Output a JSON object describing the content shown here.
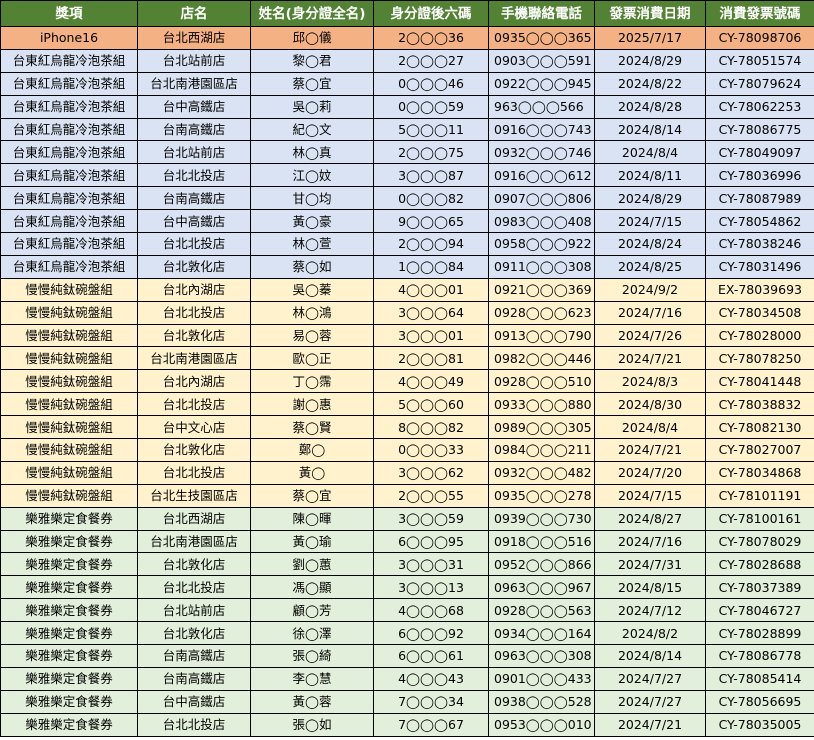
{
  "header": [
    "獎項",
    "店名",
    "姓名(身分證全名)",
    "身分證後六碼",
    "手機聯絡電話",
    "發票消費日期",
    "消費發票號碼"
  ],
  "group_colors": {
    "iphone": "#f4b183",
    "tea": "#dae3f3",
    "bowl": "#fff2cc",
    "voucher": "#e2efda",
    "header": "#548235"
  },
  "rows": [
    {
      "group": "iphone",
      "prize": "iPhone16",
      "store": "台北西湖店",
      "name": "邱◯儀",
      "id": "2◯◯◯36",
      "phone": "0935◯◯◯365",
      "date": "2025/7/17",
      "invoice": "CY-78098706"
    },
    {
      "group": "tea",
      "prize": "台東紅烏龍冷泡茶組",
      "store": "台北站前店",
      "name": "黎◯君",
      "id": "2◯◯◯27",
      "phone": "0903◯◯◯591",
      "date": "2024/8/29",
      "invoice": "CY-78051574"
    },
    {
      "group": "tea",
      "prize": "台東紅烏龍冷泡茶組",
      "store": "台北南港園區店",
      "name": "蔡◯宜",
      "id": "0◯◯◯46",
      "phone": "0922◯◯◯945",
      "date": "2024/8/22",
      "invoice": "CY-78079624"
    },
    {
      "group": "tea",
      "prize": "台東紅烏龍冷泡茶組",
      "store": "台中高鐵店",
      "name": "吳◯莉",
      "id": "0◯◯◯59",
      "phone": "963◯◯◯566",
      "date": "2024/8/28",
      "invoice": "CY-78062253"
    },
    {
      "group": "tea",
      "prize": "台東紅烏龍冷泡茶組",
      "store": "台南高鐵店",
      "name": "紀◯文",
      "id": "5◯◯◯11",
      "phone": "0916◯◯◯743",
      "date": "2024/8/14",
      "invoice": "CY-78086775"
    },
    {
      "group": "tea",
      "prize": "台東紅烏龍冷泡茶組",
      "store": "台北站前店",
      "name": "林◯真",
      "id": "2◯◯◯75",
      "phone": "0932◯◯◯746",
      "date": "2024/8/4",
      "invoice": "CY-78049097"
    },
    {
      "group": "tea",
      "prize": "台東紅烏龍冷泡茶組",
      "store": "台北北投店",
      "name": "江◯妏",
      "id": "3◯◯◯87",
      "phone": "0916◯◯◯612",
      "date": "2024/8/11",
      "invoice": "CY-78036996"
    },
    {
      "group": "tea",
      "prize": "台東紅烏龍冷泡茶組",
      "store": "台南高鐵店",
      "name": "甘◯均",
      "id": "0◯◯◯82",
      "phone": "0907◯◯◯806",
      "date": "2024/8/29",
      "invoice": "CY-78087989"
    },
    {
      "group": "tea",
      "prize": "台東紅烏龍冷泡茶組",
      "store": "台中高鐵店",
      "name": "黃◯豪",
      "id": "9◯◯◯65",
      "phone": "0983◯◯◯408",
      "date": "2024/7/15",
      "invoice": "CY-78054862"
    },
    {
      "group": "tea",
      "prize": "台東紅烏龍冷泡茶組",
      "store": "台北北投店",
      "name": "林◯萱",
      "id": "2◯◯◯94",
      "phone": "0958◯◯◯922",
      "date": "2024/8/24",
      "invoice": "CY-78038246"
    },
    {
      "group": "tea",
      "prize": "台東紅烏龍冷泡茶組",
      "store": "台北敦化店",
      "name": "蔡◯如",
      "id": "1◯◯◯84",
      "phone": "0911◯◯◯308",
      "date": "2024/8/25",
      "invoice": "CY-78031496"
    },
    {
      "group": "bowl",
      "prize": "慢慢純鈦碗盤組",
      "store": "台北內湖店",
      "name": "吳◯蓁",
      "id": "4◯◯◯01",
      "phone": "0921◯◯◯369",
      "date": "2024/9/2",
      "invoice": "EX-78039693"
    },
    {
      "group": "bowl",
      "prize": "慢慢純鈦碗盤組",
      "store": "台北北投店",
      "name": "林◯鴻",
      "id": "3◯◯◯64",
      "phone": "0928◯◯◯623",
      "date": "2024/7/16",
      "invoice": "CY-78034508"
    },
    {
      "group": "bowl",
      "prize": "慢慢純鈦碗盤組",
      "store": "台北敦化店",
      "name": "易◯蓉",
      "id": "3◯◯◯01",
      "phone": "0913◯◯◯790",
      "date": "2024/7/26",
      "invoice": "CY-78028000"
    },
    {
      "group": "bowl",
      "prize": "慢慢純鈦碗盤組",
      "store": "台北南港園區店",
      "name": "歐◯正",
      "id": "2◯◯◯81",
      "phone": "0982◯◯◯446",
      "date": "2024/7/21",
      "invoice": "CY-78078250"
    },
    {
      "group": "bowl",
      "prize": "慢慢純鈦碗盤組",
      "store": "台北內湖店",
      "name": "丁◯霈",
      "id": "4◯◯◯49",
      "phone": "0928◯◯◯510",
      "date": "2024/8/3",
      "invoice": "CY-78041448"
    },
    {
      "group": "bowl",
      "prize": "慢慢純鈦碗盤組",
      "store": "台北北投店",
      "name": "謝◯惠",
      "id": "5◯◯◯60",
      "phone": "0933◯◯◯880",
      "date": "2024/8/30",
      "invoice": "CY-78038832"
    },
    {
      "group": "bowl",
      "prize": "慢慢純鈦碗盤組",
      "store": "台中文心店",
      "name": "蔡◯賢",
      "id": "8◯◯◯82",
      "phone": "0989◯◯◯305",
      "date": "2024/8/4",
      "invoice": "CY-78082130"
    },
    {
      "group": "bowl",
      "prize": "慢慢純鈦碗盤組",
      "store": "台北敦化店",
      "name": "鄭◯",
      "id": "0◯◯◯33",
      "phone": "0984◯◯◯211",
      "date": "2024/7/21",
      "invoice": "CY-78027007"
    },
    {
      "group": "bowl",
      "prize": "慢慢純鈦碗盤組",
      "store": "台北北投店",
      "name": "黃◯",
      "id": "3◯◯◯62",
      "phone": "0932◯◯◯482",
      "date": "2024/7/20",
      "invoice": "CY-78034868"
    },
    {
      "group": "bowl",
      "prize": "慢慢純鈦碗盤組",
      "store": "台北生技園區店",
      "name": "蔡◯宜",
      "id": "2◯◯◯55",
      "phone": "0935◯◯◯278",
      "date": "2024/7/15",
      "invoice": "CY-78101191"
    },
    {
      "group": "voucher",
      "prize": "樂雅樂定食餐券",
      "store": "台北西湖店",
      "name": "陳◯暉",
      "id": "3◯◯◯59",
      "phone": "0939◯◯◯730",
      "date": "2024/8/27",
      "invoice": "CY-78100161"
    },
    {
      "group": "voucher",
      "prize": "樂雅樂定食餐券",
      "store": "台北南港園區店",
      "name": "黃◯瑜",
      "id": "6◯◯◯95",
      "phone": "0918◯◯◯516",
      "date": "2024/7/16",
      "invoice": "CY-78078029"
    },
    {
      "group": "voucher",
      "prize": "樂雅樂定食餐券",
      "store": "台北敦化店",
      "name": "劉◯蕙",
      "id": "3◯◯◯31",
      "phone": "0952◯◯◯866",
      "date": "2024/7/31",
      "invoice": "CY-78028688"
    },
    {
      "group": "voucher",
      "prize": "樂雅樂定食餐券",
      "store": "台北北投店",
      "name": "馮◯顯",
      "id": "3◯◯◯13",
      "phone": "0963◯◯◯967",
      "date": "2024/8/15",
      "invoice": "CY-78037389"
    },
    {
      "group": "voucher",
      "prize": "樂雅樂定食餐券",
      "store": "台北站前店",
      "name": "顧◯芳",
      "id": "4◯◯◯68",
      "phone": "0928◯◯◯563",
      "date": "2024/7/12",
      "invoice": "CY-78046727"
    },
    {
      "group": "voucher",
      "prize": "樂雅樂定食餐券",
      "store": "台北敦化店",
      "name": "徐◯澤",
      "id": "6◯◯◯92",
      "phone": "0934◯◯◯164",
      "date": "2024/8/2",
      "invoice": "CY-78028899"
    },
    {
      "group": "voucher",
      "prize": "樂雅樂定食餐券",
      "store": "台南高鐵店",
      "name": "張◯綺",
      "id": "6◯◯◯61",
      "phone": "0963◯◯◯308",
      "date": "2024/8/14",
      "invoice": "CY-78086778"
    },
    {
      "group": "voucher",
      "prize": "樂雅樂定食餐券",
      "store": "台南高鐵店",
      "name": "李◯慧",
      "id": "4◯◯◯43",
      "phone": "0901◯◯◯433",
      "date": "2024/7/27",
      "invoice": "CY-78085414"
    },
    {
      "group": "voucher",
      "prize": "樂雅樂定食餐券",
      "store": "台中高鐵店",
      "name": "黃◯蓉",
      "id": "7◯◯◯34",
      "phone": "0938◯◯◯528",
      "date": "2024/7/27",
      "invoice": "CY-78056695"
    },
    {
      "group": "voucher",
      "prize": "樂雅樂定食餐券",
      "store": "台北北投店",
      "name": "張◯如",
      "id": "7◯◯◯67",
      "phone": "0953◯◯◯010",
      "date": "2024/7/21",
      "invoice": "CY-78035005"
    }
  ]
}
